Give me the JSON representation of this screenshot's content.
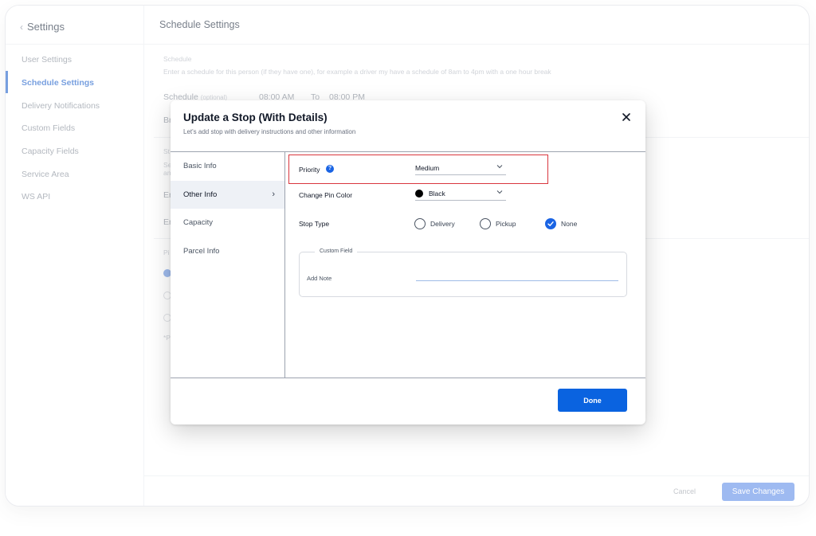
{
  "sidebar": {
    "back_label": "Settings",
    "items": [
      {
        "label": "User Settings",
        "active": false
      },
      {
        "label": "Schedule Settings",
        "active": true
      },
      {
        "label": "Delivery Notifications",
        "active": false
      },
      {
        "label": "Custom Fields",
        "active": false
      },
      {
        "label": "Capacity Fields",
        "active": false
      },
      {
        "label": "Service Area",
        "active": false
      },
      {
        "label": "WS API",
        "active": false
      }
    ]
  },
  "main": {
    "title": "Schedule Settings",
    "section_label": "Schedule",
    "section_description": "Enter a schedule for this person (if they have one), for example a driver my have a schedule of 8am to 4pm with a one hour break",
    "schedule_label": "Schedule",
    "schedule_optional": "(optional)",
    "start_time": "08:00 AM",
    "to_label": "To",
    "end_time": "08:00 PM",
    "partial_labels": [
      "Br",
      "St",
      "Se",
      "an",
      "Er",
      "Er",
      "Pi"
    ],
    "footnote_partial": "*P"
  },
  "footer": {
    "cancel_label": "Cancel",
    "save_label": "Save Changes"
  },
  "modal": {
    "title": "Update a Stop (With Details)",
    "subtitle": "Let's add stop with delivery instructions and other information",
    "tabs": [
      {
        "label": "Basic Info",
        "active": false
      },
      {
        "label": "Other Info",
        "active": true
      },
      {
        "label": "Capacity",
        "active": false
      },
      {
        "label": "Parcel Info",
        "active": false
      }
    ],
    "priority": {
      "label": "Priority",
      "value": "Medium"
    },
    "pin_color": {
      "label": "Change Pin Color",
      "value": "Black",
      "color": "#000000"
    },
    "stop_type": {
      "label": "Stop Type",
      "options": [
        {
          "label": "Delivery",
          "checked": false
        },
        {
          "label": "Pickup",
          "checked": false
        },
        {
          "label": "None",
          "checked": true
        }
      ]
    },
    "custom_field": {
      "legend": "Custom Field",
      "note_label": "Add Note",
      "note_value": ""
    },
    "done_label": "Done"
  },
  "colors": {
    "accent": "#0a63e0",
    "highlight": "#d9363e",
    "sidebar_active": "#4a7fd4"
  }
}
